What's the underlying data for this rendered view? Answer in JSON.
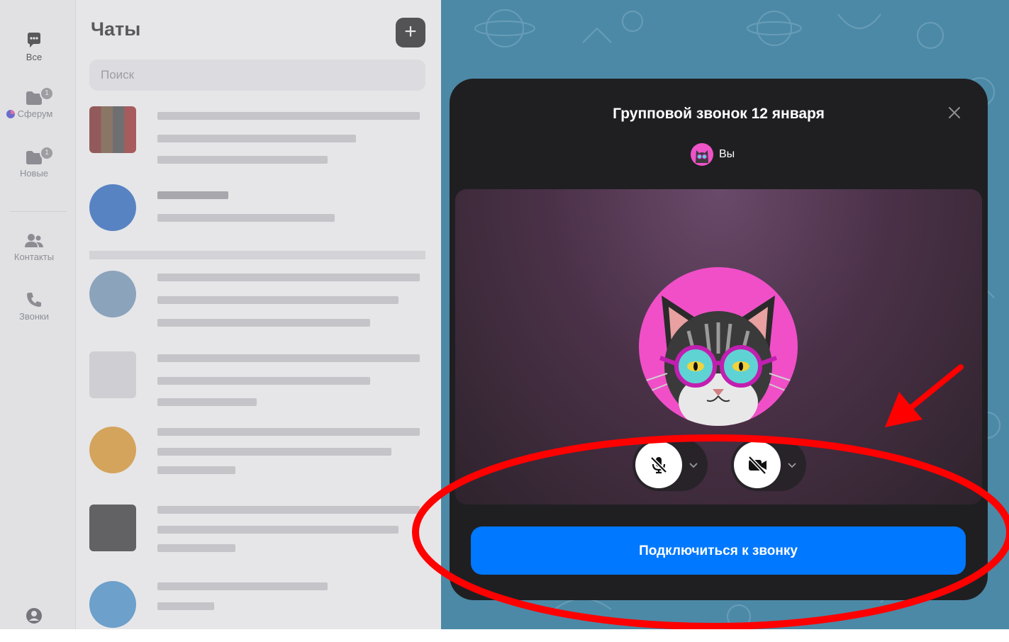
{
  "nav": {
    "items": [
      {
        "label": "Все",
        "icon": "chat-bubble-icon",
        "active": true
      },
      {
        "label": "Сферум",
        "icon": "folder-icon",
        "badge": "1"
      },
      {
        "label": "Новые",
        "icon": "folder-icon",
        "badge": "1"
      },
      {
        "label": "Контакты",
        "icon": "contacts-icon"
      },
      {
        "label": "Звонки",
        "icon": "phone-icon"
      }
    ],
    "profile_icon": "profile-icon"
  },
  "chats": {
    "title": "Чаты",
    "new_chat_glyph": "+",
    "search_placeholder": "Поиск"
  },
  "call_modal": {
    "title": "Групповой звонок 12 января",
    "participant_name": "Вы",
    "microphone": {
      "state": "muted",
      "icon": "microphone-off-icon"
    },
    "camera": {
      "state": "off",
      "icon": "camera-off-icon"
    },
    "join_button": "Подключиться к звонку"
  },
  "colors": {
    "accent": "#0078ff",
    "modal_background": "#1f1f22",
    "avatar_background": "#f04fc8",
    "annotation": "#ff0000",
    "chat_background": "#4c89a6"
  }
}
